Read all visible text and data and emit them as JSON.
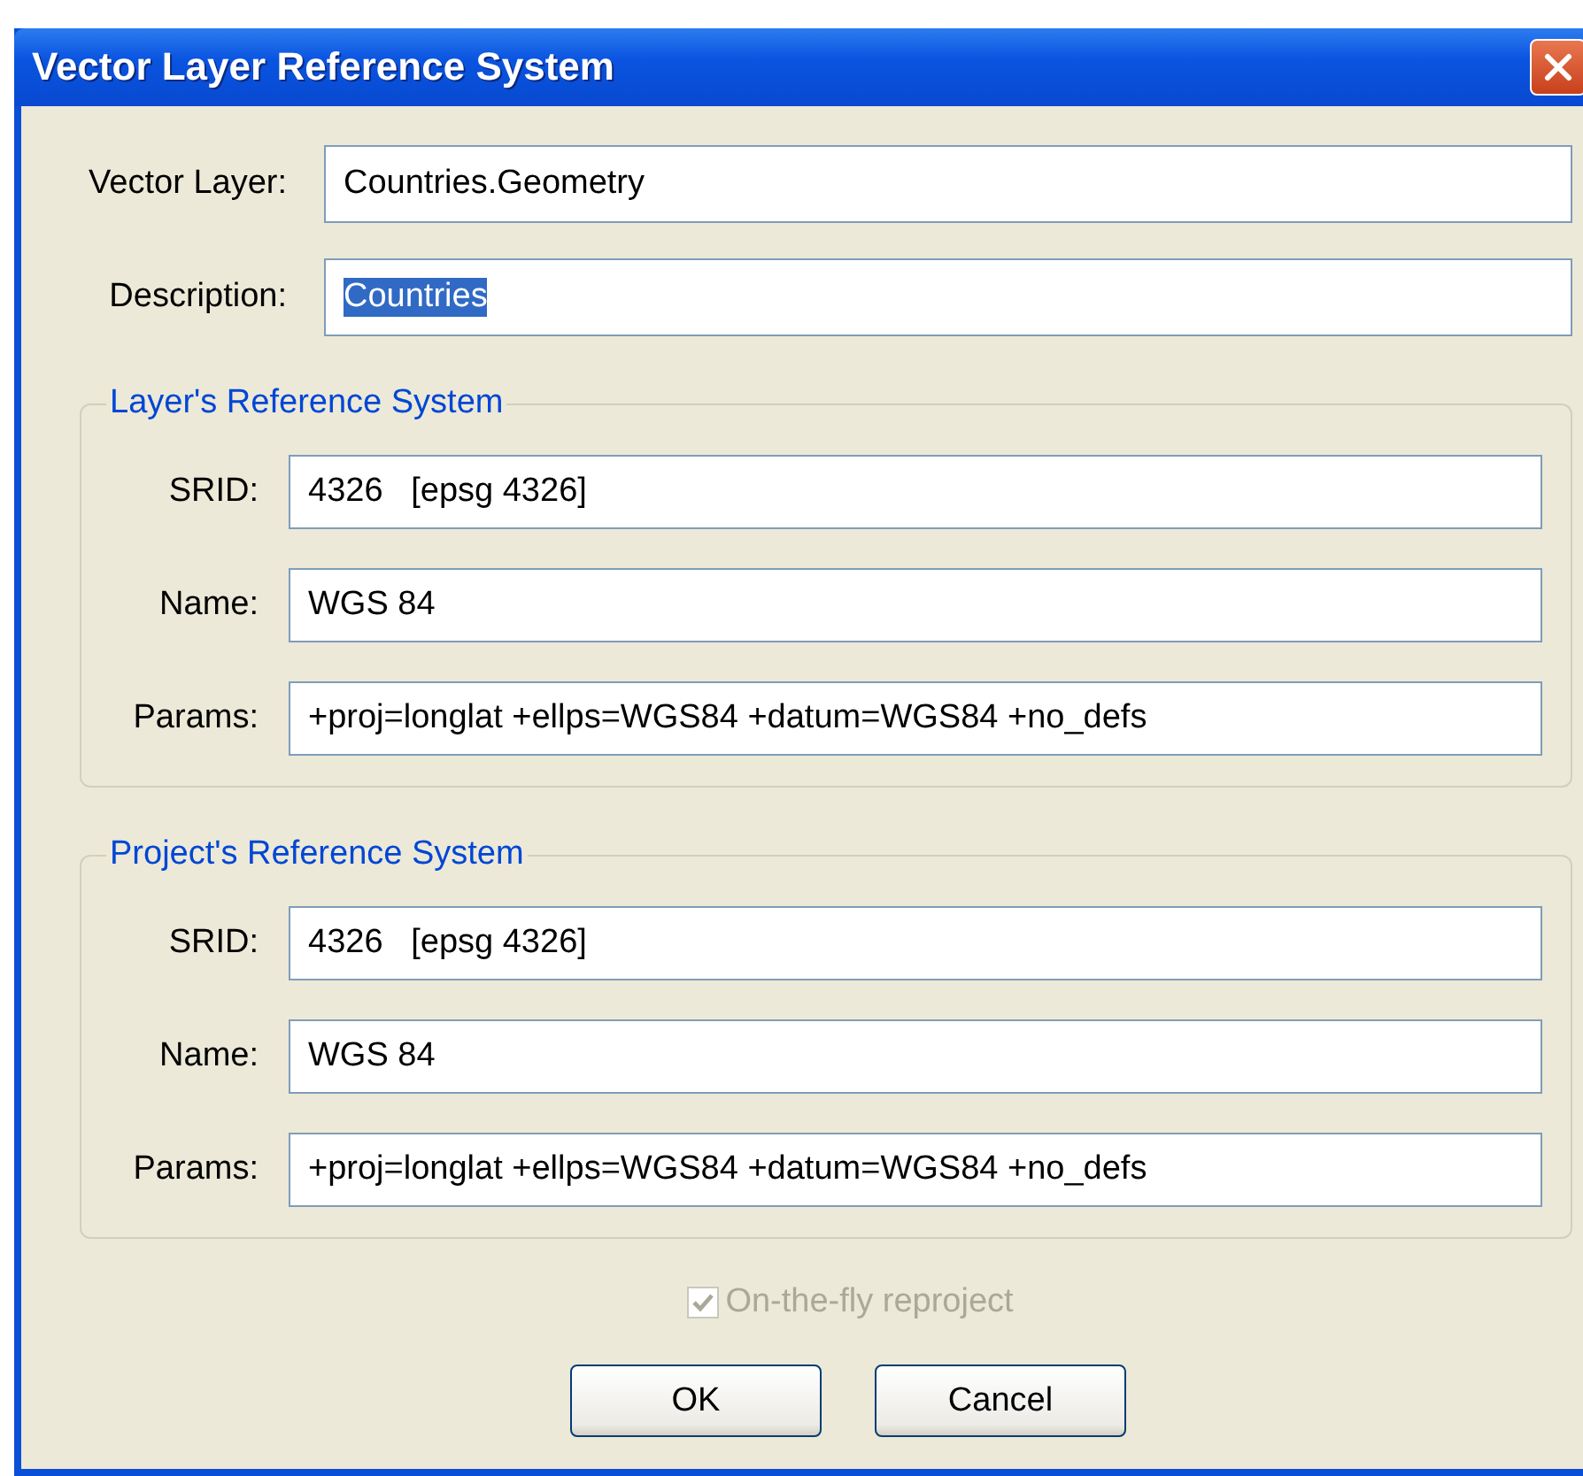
{
  "window": {
    "title": "Vector Layer Reference System"
  },
  "fields": [
    {
      "label": "Vector Layer:",
      "value": "Countries.Geometry",
      "text_selected": false
    },
    {
      "label": "Description:",
      "value": "Countries",
      "text_selected": true
    }
  ],
  "groups": [
    {
      "title": "Layer's Reference System",
      "fields": [
        {
          "label": "SRID:",
          "value": "4326   [epsg 4326]"
        },
        {
          "label": "Name:",
          "value": "WGS 84"
        },
        {
          "label": "Params:",
          "value": "+proj=longlat +ellps=WGS84 +datum=WGS84 +no_defs"
        }
      ]
    },
    {
      "title": "Project's Reference System",
      "fields": [
        {
          "label": "SRID:",
          "value": "4326   [epsg 4326]"
        },
        {
          "label": "Name:",
          "value": "WGS 84"
        },
        {
          "label": "Params:",
          "value": "+proj=longlat +ellps=WGS84 +datum=WGS84 +no_defs"
        }
      ]
    }
  ],
  "reproject": {
    "label": "On-the-fly reproject",
    "checked": true,
    "disabled": true
  },
  "buttons": [
    "OK",
    "Cancel"
  ]
}
